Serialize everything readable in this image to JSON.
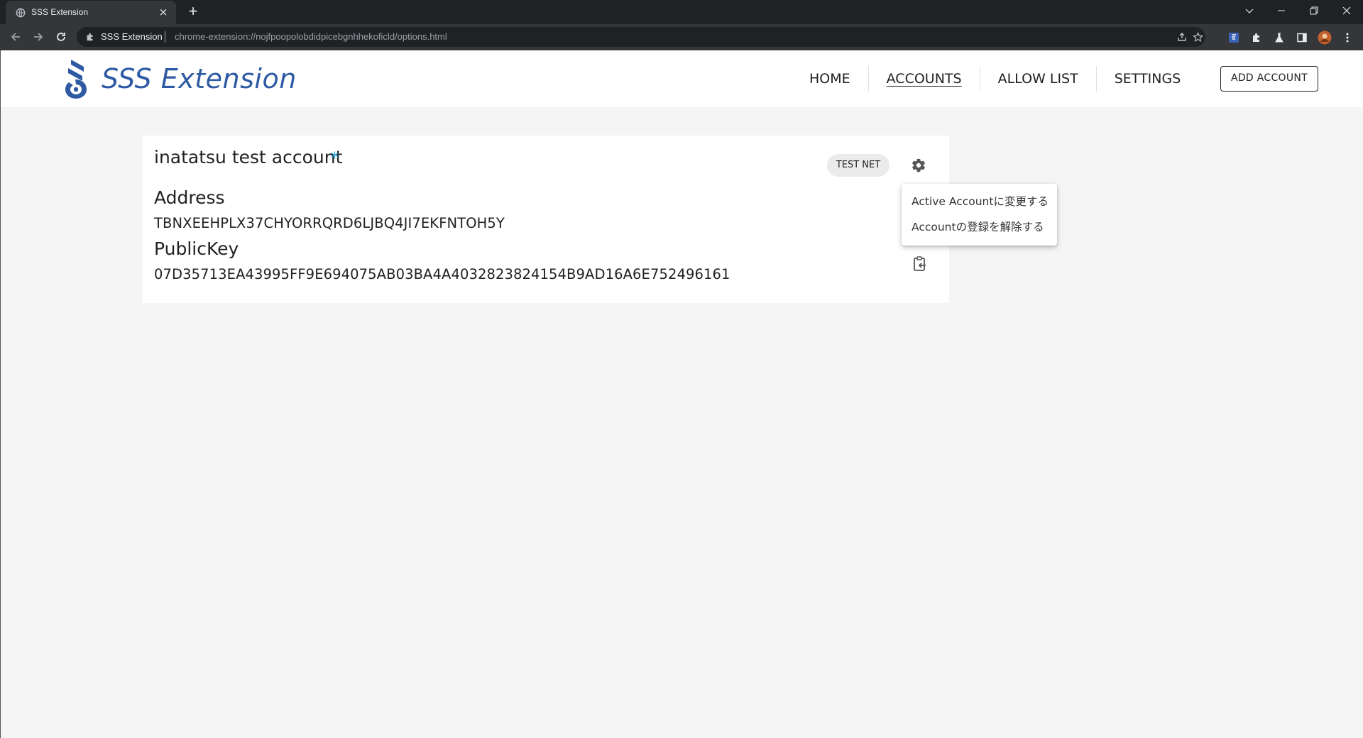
{
  "browser": {
    "tab_title": "SSS Extension",
    "tab_close": "×",
    "new_tab": "+",
    "site_name": "SSS Extension",
    "url": "chrome-extension://nojfpoopolobdidpicebgnhhekoficld/options.html"
  },
  "header": {
    "brand": "SSS Extension",
    "nav": [
      "HOME",
      "ACCOUNTS",
      "ALLOW LIST",
      "SETTINGS"
    ],
    "active_nav": "ACCOUNTS",
    "add_account": "ADD ACCOUNT"
  },
  "account": {
    "name": "inatatsu test account",
    "active_mark": "*",
    "network": "TEST NET",
    "address_label": "Address",
    "address": "TBNXEEHPLX37CHYORRQRD6LJBQ4JI7EKFNTOH5Y",
    "pubkey_label": "PublicKey",
    "pubkey": "07D35713EA43995FF9E694075AB03BA4A4032823824154B9AD16A6E752496161"
  },
  "menu": {
    "items": [
      "Active Accountに変更する",
      "Accountの登録を解除する"
    ]
  },
  "colors": {
    "brand": "#2e5aa3",
    "star": "#29a8e0",
    "page_bg": "#f5f5f5"
  }
}
